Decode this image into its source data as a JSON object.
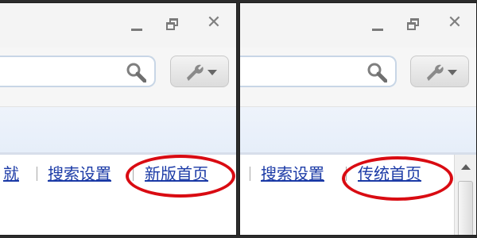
{
  "left": {
    "links": [
      "就",
      "搜索设置",
      "新版首页"
    ]
  },
  "right": {
    "links": [
      "搜索设置",
      "传统首页"
    ]
  },
  "colors": {
    "link": "#1b3aa6",
    "highlight": "#d90b12",
    "toolbar_band": "#e6eef9"
  },
  "icons": [
    "minimize-icon",
    "restore-icon",
    "close-icon",
    "search-icon",
    "wrench-icon",
    "chevron-down-icon",
    "scroll-up-icon"
  ]
}
